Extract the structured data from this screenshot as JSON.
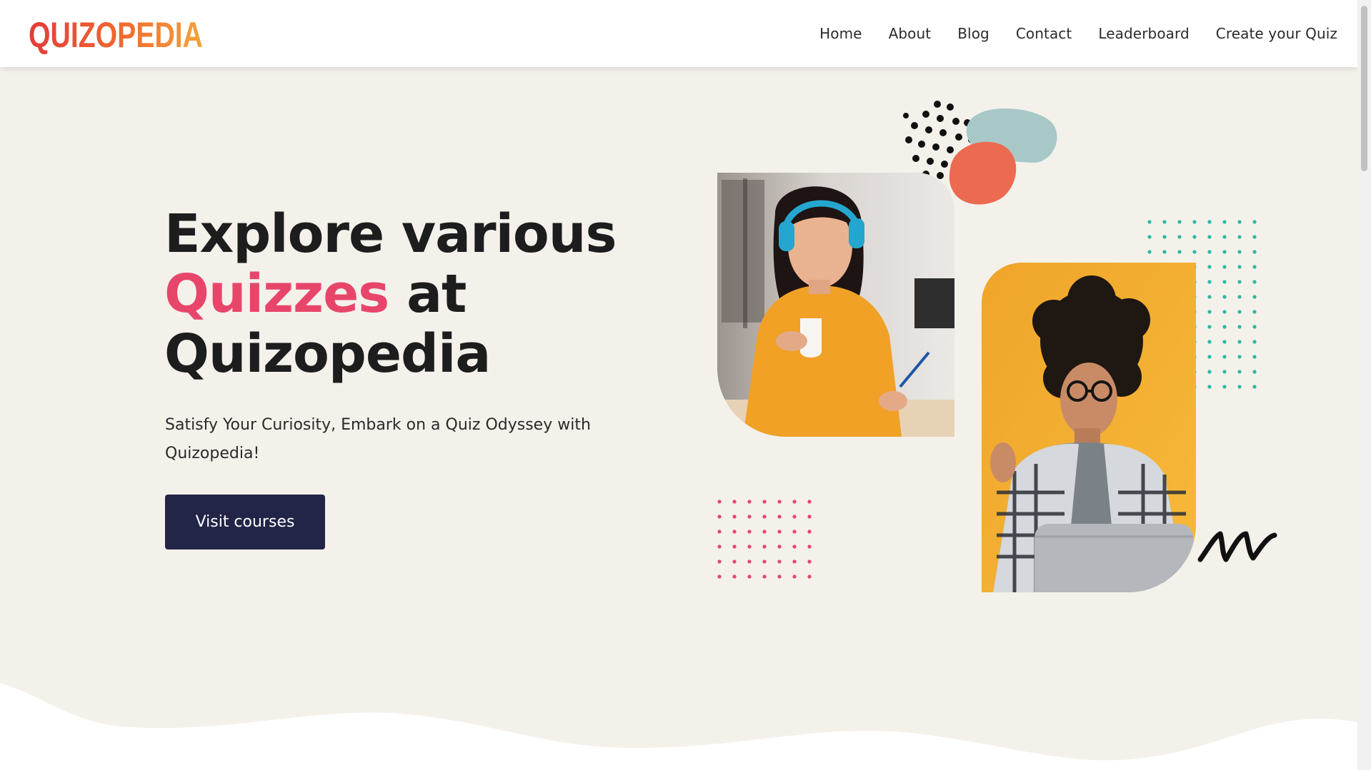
{
  "brand": {
    "logo_text": "QUIZOPEDIA"
  },
  "nav": {
    "home": "Home",
    "about": "About",
    "blog": "Blog",
    "contact": "Contact",
    "leaderboard": "Leaderboard",
    "create_quiz": "Create your Quiz"
  },
  "hero": {
    "title_line1": "Explore various",
    "title_highlight": "Quizzes",
    "title_after_highlight": " at",
    "title_line3": "Quizopedia",
    "subtitle": "Satisfy Your Curiosity, Embark on a Quiz Odyssey with Quizopedia!",
    "cta_label": "Visit courses"
  },
  "colors": {
    "accent": "#e8456b",
    "navy": "#222448",
    "background": "#f4f1eb",
    "yellow": "#f0a92a",
    "teal": "#2fb7a4"
  }
}
